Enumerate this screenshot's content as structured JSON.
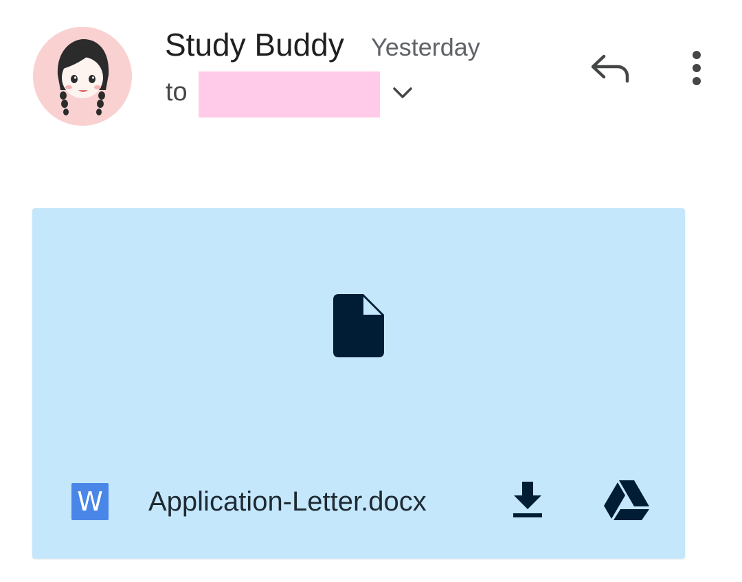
{
  "message_header": {
    "sender_name": "Study Buddy",
    "date": "Yesterday",
    "to_label": "to",
    "avatar_icon": "girl-avatar-icon",
    "redaction_color": "#ffcbe8",
    "actions": {
      "reply_icon": "reply-icon",
      "more_icon": "more-vert-icon",
      "expand_icon": "chevron-down-icon"
    }
  },
  "attachment": {
    "file_name": "Application-Letter.docx",
    "type_badge": "W",
    "preview_icon": "file-icon",
    "download_icon": "download-icon",
    "drive_icon": "google-drive-icon",
    "card_color": "#c4e7fc",
    "badge_color": "#4a86e8"
  }
}
